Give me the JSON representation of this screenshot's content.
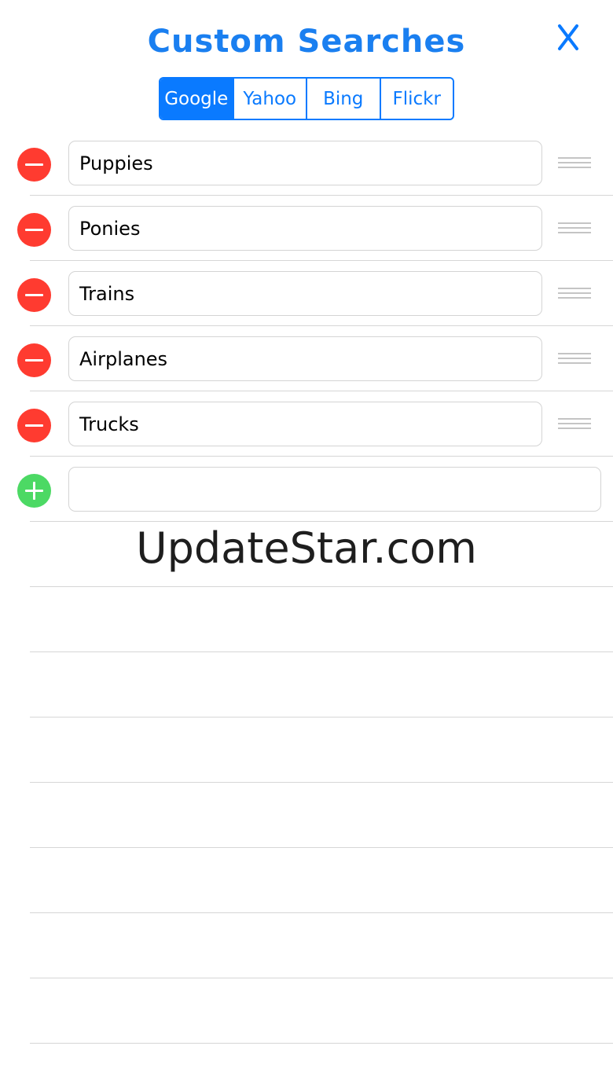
{
  "header": {
    "title": "Custom Searches",
    "close_icon": "close-x-icon",
    "accent_color": "#0a7aff"
  },
  "engines": {
    "selected": "Google",
    "tabs": [
      {
        "label": "Google",
        "selected": true
      },
      {
        "label": "Yahoo",
        "selected": false
      },
      {
        "label": "Bing",
        "selected": false
      },
      {
        "label": "Flickr",
        "selected": false
      }
    ]
  },
  "searches": [
    {
      "value": "Puppies"
    },
    {
      "value": "Ponies"
    },
    {
      "value": "Trains"
    },
    {
      "value": "Airplanes"
    },
    {
      "value": "Trucks"
    }
  ],
  "new_search": {
    "value": "",
    "placeholder": ""
  },
  "icons": {
    "remove": "minus-circle-icon",
    "add": "plus-circle-icon",
    "reorder": "reorder-icon",
    "remove_color": "#ff3b30",
    "add_color": "#4cd964"
  },
  "watermark": "UpdateStar.com"
}
